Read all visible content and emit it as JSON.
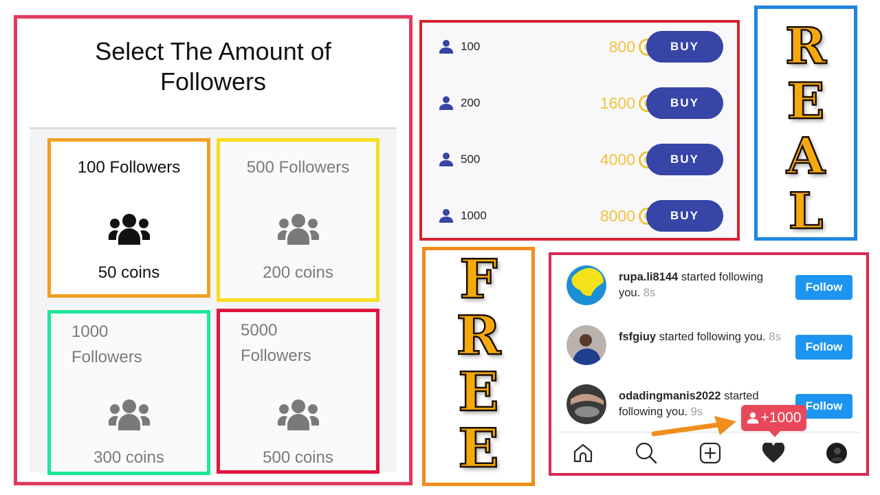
{
  "left_panel": {
    "title_line1": "Select The Amount of",
    "title_line2": "Followers",
    "packages": [
      {
        "followers": "100 Followers",
        "coins": "50 coins",
        "state": "selected",
        "border_color": "#f0a020"
      },
      {
        "followers": "500 Followers",
        "coins": "200 coins",
        "state": "muted",
        "border_color": "#f7dd1c"
      },
      {
        "followers_line1": "1000",
        "followers_line2": "Followers",
        "coins": "300 coins",
        "state": "muted",
        "border_color": "#1de89a"
      },
      {
        "followers_line1": "5000",
        "followers_line2": "Followers",
        "coins": "500 coins",
        "state": "muted",
        "border_color": "#e0163e"
      }
    ],
    "icon": "group-icon"
  },
  "buy_panel": {
    "rows": [
      {
        "qty": "100",
        "price": "800",
        "button": "BUY"
      },
      {
        "qty": "200",
        "price": "1600",
        "button": "BUY"
      },
      {
        "qty": "500",
        "price": "4000",
        "button": "BUY"
      },
      {
        "qty": "1000",
        "price": "8000",
        "button": "BUY"
      }
    ],
    "coin_symbol": "C",
    "accent_color": "#3645a6",
    "price_color": "#f0c33c"
  },
  "real_label": {
    "letters": [
      "R",
      "E",
      "A",
      "L"
    ]
  },
  "free_label": {
    "letters": [
      "F",
      "R",
      "E",
      "E"
    ]
  },
  "notifications": {
    "items": [
      {
        "username": "rupa.li8144",
        "message": "started following you.",
        "time": "8s",
        "button": "Follow"
      },
      {
        "username": "fsfgiuy",
        "message": "started following you.",
        "time": "8s",
        "button": "Follow"
      },
      {
        "username": "odadingmanis2022",
        "message": "started following you.",
        "time": "9s",
        "button": "Follow"
      }
    ],
    "badge": "+1000",
    "tabs": [
      "home-icon",
      "search-icon",
      "add-post-icon",
      "heart-icon",
      "profile-avatar"
    ]
  }
}
